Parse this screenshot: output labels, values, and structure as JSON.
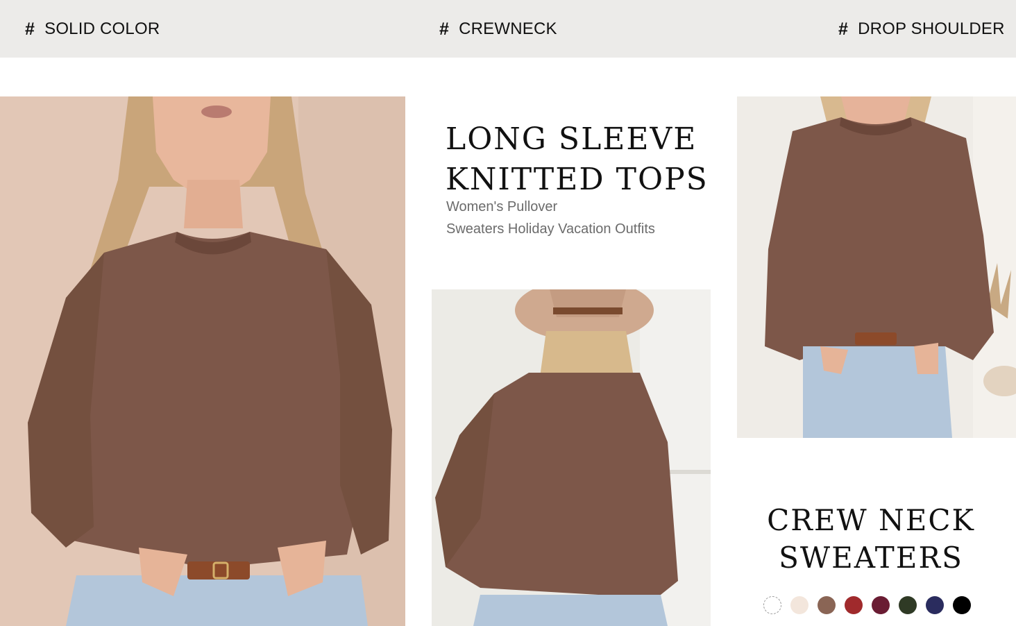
{
  "tags": [
    {
      "symbol": "#",
      "label": "SOLID COLOR"
    },
    {
      "symbol": "#",
      "label": "CREWNECK"
    },
    {
      "symbol": "#",
      "label": "DROP SHOULDER"
    }
  ],
  "headline": {
    "line1": "LONG SLEEVE",
    "line2": "KNITTED TOPS"
  },
  "subtitle": {
    "line1": "Women's Pullover",
    "line2": "Sweaters Holiday Vacation Outfits"
  },
  "crew_title": {
    "line1": "CREW NECK",
    "line2": "SWEATERS"
  },
  "swatches": [
    "#ffffff",
    "#f3e6dc",
    "#8a6555",
    "#a02a2c",
    "#6a1c33",
    "#2f3a25",
    "#2a2c5e",
    "#000000"
  ],
  "colors": {
    "sweater": "#7d5749",
    "jeans": "#b3c6da",
    "tagbar": "#ecebe9"
  }
}
